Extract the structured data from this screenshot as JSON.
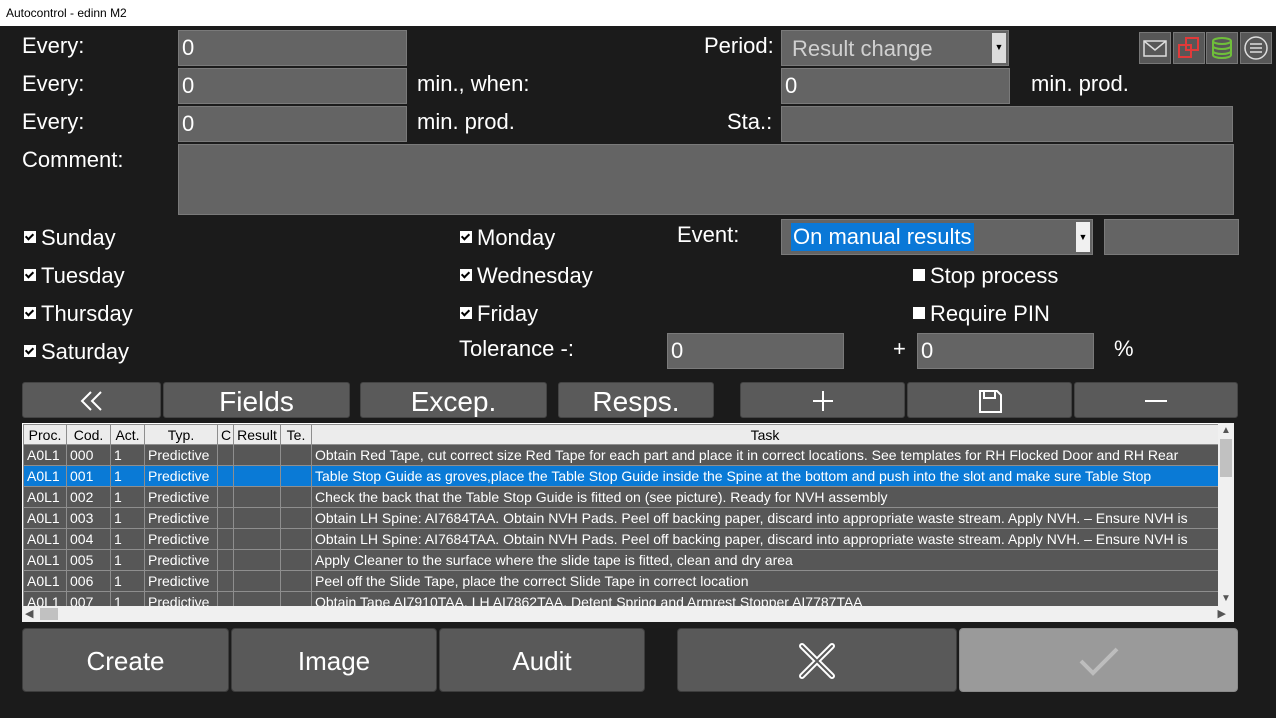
{
  "window": {
    "title": "Autocontrol - edinn M2"
  },
  "form": {
    "every1_label": "Every:",
    "every1_value": "0",
    "period_label": "Period:",
    "period_value": "Result change",
    "every2_label": "Every:",
    "every2_value": "0",
    "min_when_label": "min., when:",
    "when_value": "0",
    "min_prod_label1": "min. prod.",
    "every3_label": "Every:",
    "every3_value": "0",
    "min_prod_label2": "min. prod.",
    "sta_label": "Sta.:",
    "sta_value": "",
    "comment_label": "Comment:",
    "comment_value": "",
    "event_label": "Event:",
    "event_value": "On manual results",
    "event_extra_value": "",
    "tolerance_label": "Tolerance -:",
    "tolerance_minus_value": "0",
    "plus_label": "+",
    "tolerance_plus_value": "0",
    "percent_label": "%"
  },
  "days": {
    "sunday": {
      "label": "Sunday",
      "checked": true
    },
    "monday": {
      "label": "Monday",
      "checked": true
    },
    "tuesday": {
      "label": "Tuesday",
      "checked": true
    },
    "wednesday": {
      "label": "Wednesday",
      "checked": true
    },
    "thursday": {
      "label": "Thursday",
      "checked": true
    },
    "friday": {
      "label": "Friday",
      "checked": true
    },
    "saturday": {
      "label": "Saturday",
      "checked": true
    }
  },
  "options": {
    "stop_process": {
      "label": "Stop process",
      "checked": false
    },
    "require_pin": {
      "label": "Require PIN",
      "checked": false
    }
  },
  "toolbar": {
    "fields": "Fields",
    "excep": "Excep.",
    "resps": "Resps."
  },
  "table": {
    "headers": [
      "Proc.",
      "Cod.",
      "Act.",
      "Typ.",
      "C",
      "Result",
      "Te.",
      "Task"
    ],
    "rows": [
      [
        "A0L1",
        "000",
        "1",
        "Predictive",
        "",
        "",
        "",
        "Obtain Red Tape, cut correct size Red Tape for each part and place it in correct locations. See templates for RH Flocked Door and RH Rear"
      ],
      [
        "A0L1",
        "001",
        "1",
        "Predictive",
        "",
        "",
        "",
        "Table Stop Guide as groves,place the Table Stop Guide inside the Spine at the bottom and push into the slot and make sure Table Stop"
      ],
      [
        "A0L1",
        "002",
        "1",
        "Predictive",
        "",
        "",
        "",
        "Check the back that the Table Stop Guide is fitted on (see picture). Ready for NVH assembly"
      ],
      [
        "A0L1",
        "003",
        "1",
        "Predictive",
        "",
        "",
        "",
        "Obtain LH Spine: AI7684TAA. Obtain NVH Pads. Peel off backing paper, discard into appropriate waste stream. Apply NVH. – Ensure NVH is"
      ],
      [
        "A0L1",
        "004",
        "1",
        "Predictive",
        "",
        "",
        "",
        "Obtain LH Spine: AI7684TAA. Obtain NVH Pads. Peel off backing paper, discard into appropriate waste stream. Apply NVH. – Ensure NVH is"
      ],
      [
        "A0L1",
        "005",
        "1",
        "Predictive",
        "",
        "",
        "",
        "Apply Cleaner to the surface where the slide tape is fitted, clean and dry area"
      ],
      [
        "A0L1",
        "006",
        "1",
        "Predictive",
        "",
        "",
        "",
        "Peel off the Slide Tape, place the correct Slide Tape in correct location"
      ],
      [
        "A0L1",
        "007",
        "1",
        "Predictive",
        "",
        "",
        "",
        "Obtain Tape AI7910TAA,  LH AI7862TAA, Detent Spring and Armrest Stopper AI7787TAA"
      ]
    ],
    "selected_row": 1
  },
  "bottom": {
    "create": "Create",
    "image": "Image",
    "audit": "Audit"
  },
  "icons": {
    "mail": "mail-icon",
    "copy": "copy-icon",
    "database": "database-icon",
    "menu": "menu-icon"
  },
  "colors": {
    "background": "#1b1b1b",
    "field": "#646464",
    "selection": "#0a7ad6",
    "copy_icon": "#e03a3a",
    "database_icon": "#6fbf3a"
  }
}
